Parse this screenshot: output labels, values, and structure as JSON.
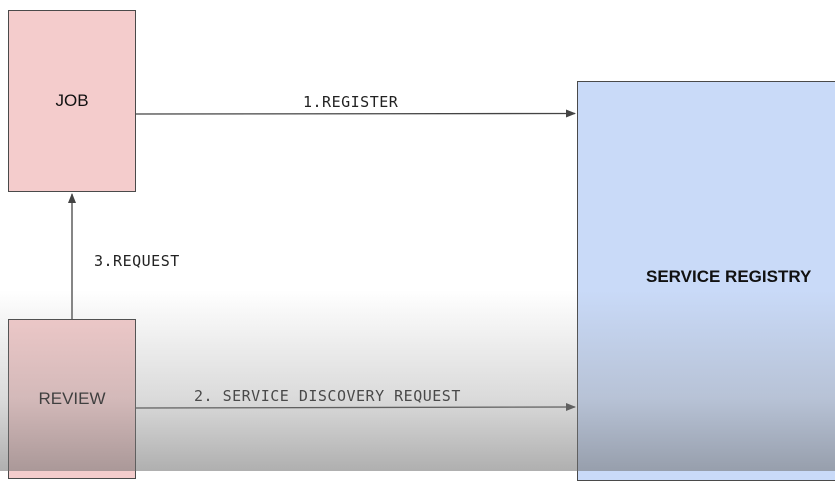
{
  "diagram": {
    "nodes": {
      "job": {
        "label": "JOB",
        "color": "#f4cccc"
      },
      "review": {
        "label": "REVIEW",
        "color": "#f4cccc"
      },
      "service_registry": {
        "label": "SERVICE REGISTRY",
        "color": "#c9daf8"
      }
    },
    "edges": [
      {
        "from": "job",
        "to": "service_registry",
        "label": "1.REGISTER"
      },
      {
        "from": "review",
        "to": "service_registry",
        "label": "2. SERVICE DISCOVERY REQUEST"
      },
      {
        "from": "review",
        "to": "job",
        "label": "3.REQUEST"
      }
    ],
    "arrow_color": "#444444",
    "border_color": "#4a4a4a"
  }
}
